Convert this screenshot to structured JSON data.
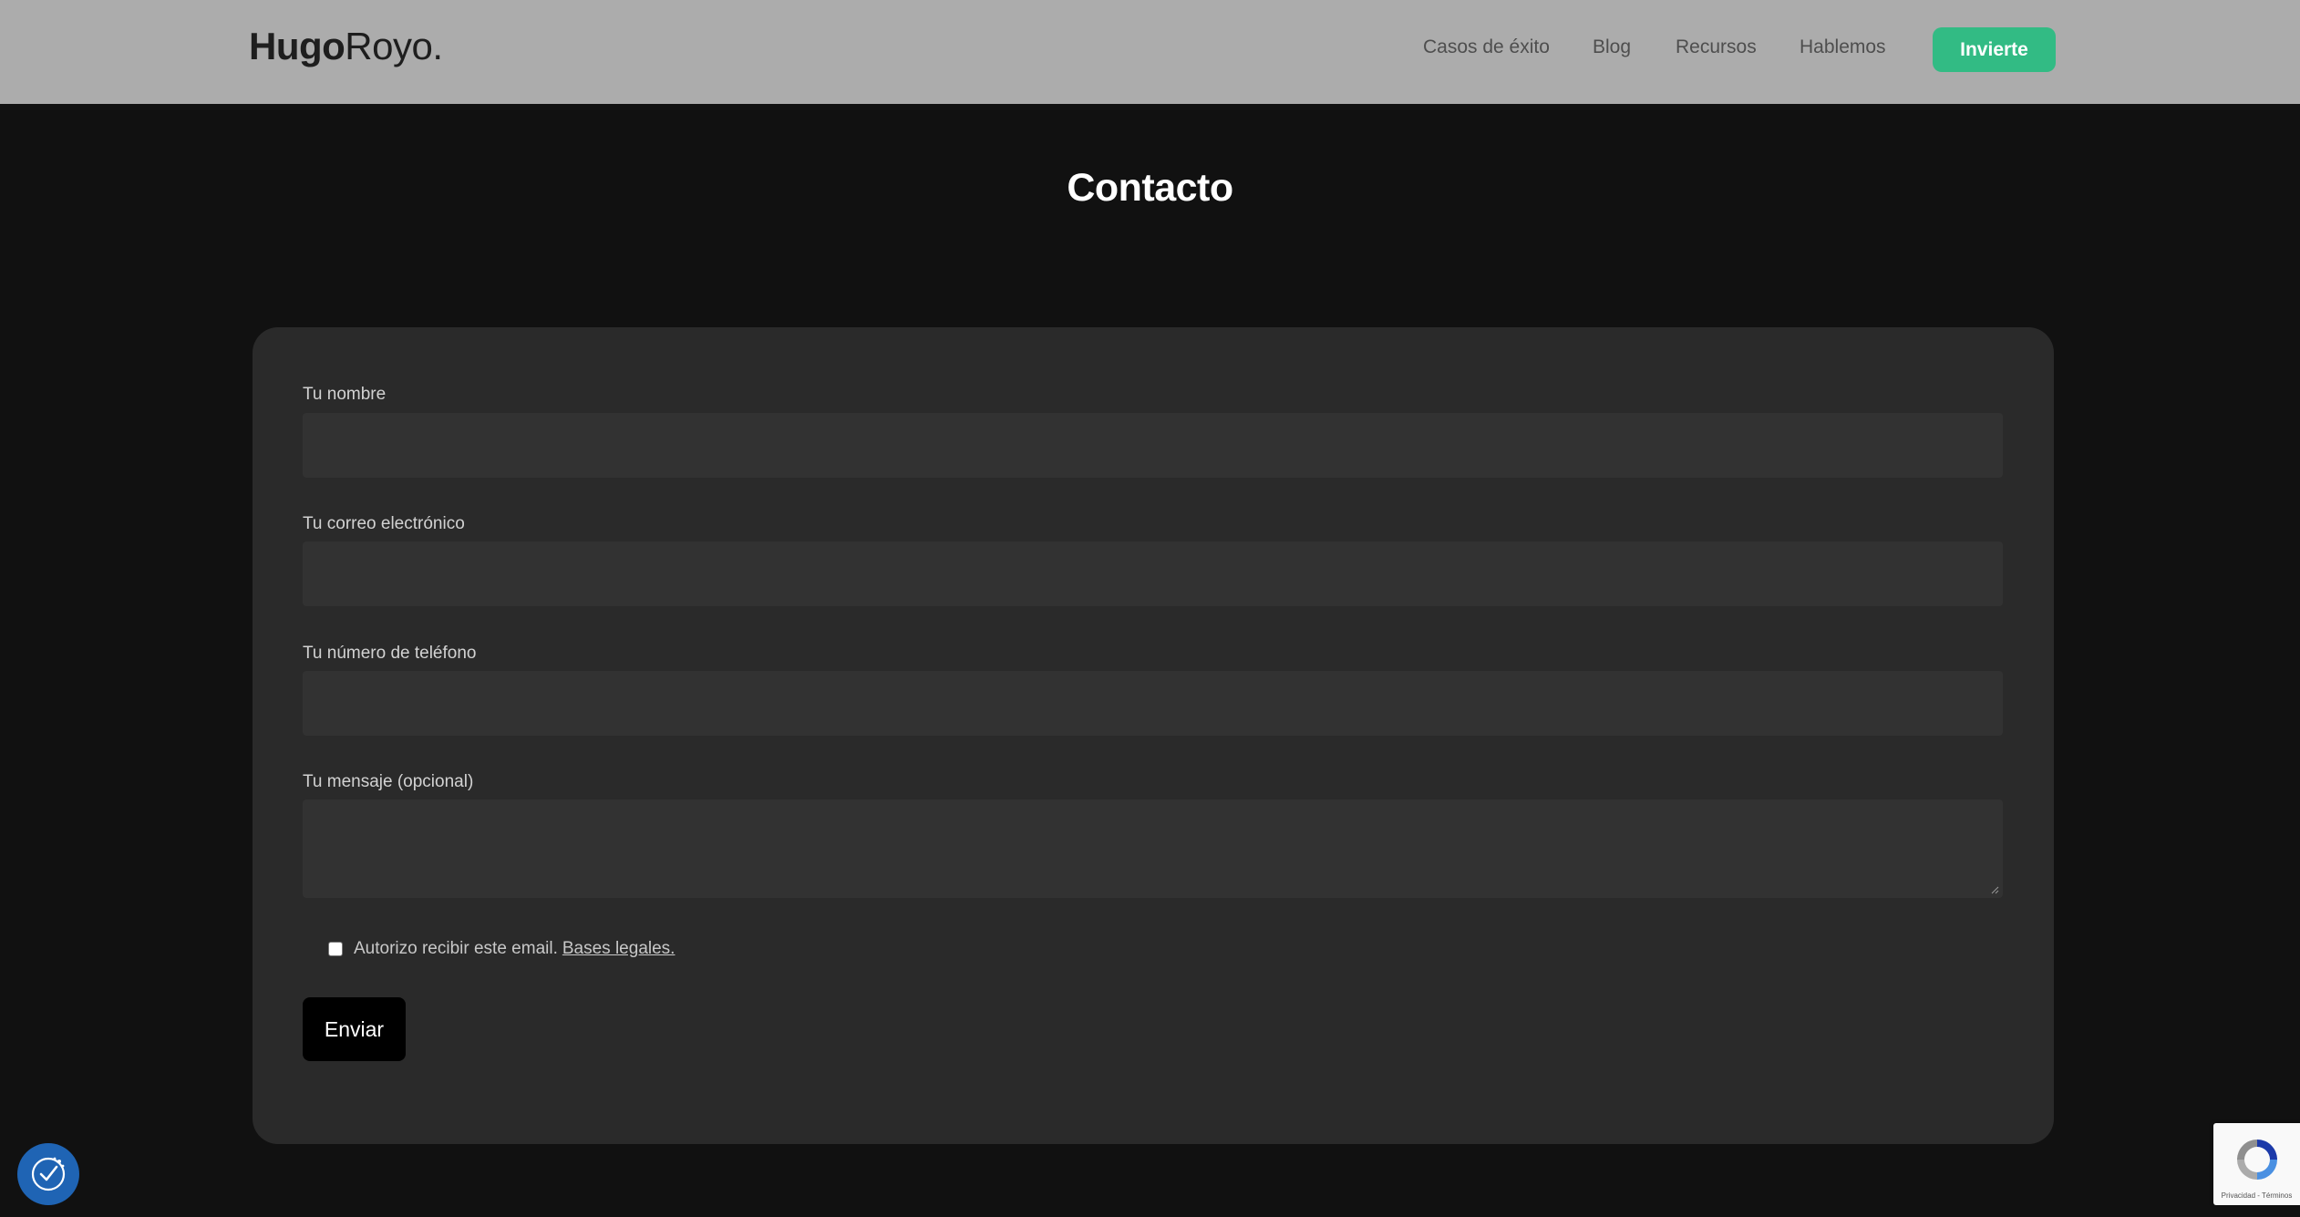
{
  "header": {
    "logo_bold": "Hugo",
    "logo_light": "Royo.",
    "nav": {
      "casos": "Casos de éxito",
      "blog": "Blog",
      "recursos": "Recursos",
      "hablemos": "Hablemos"
    },
    "cta_label": "Invierte"
  },
  "page": {
    "title": "Contacto"
  },
  "form": {
    "name_label": "Tu nombre",
    "email_label": "Tu correo electrónico",
    "phone_label": "Tu número de teléfono",
    "message_label": "Tu mensaje (opcional)",
    "consent_text": "Autorizo recibir este email.",
    "consent_link": "Bases legales.",
    "submit_label": "Enviar"
  },
  "recaptcha": {
    "text": "Privacidad - Términos"
  },
  "colors": {
    "header_bg": "#acacac",
    "page_bg": "#111111",
    "card_bg": "#2a2a2a",
    "input_bg": "#323232",
    "accent": "#32bb84",
    "cookie_button": "#1f64b4"
  }
}
